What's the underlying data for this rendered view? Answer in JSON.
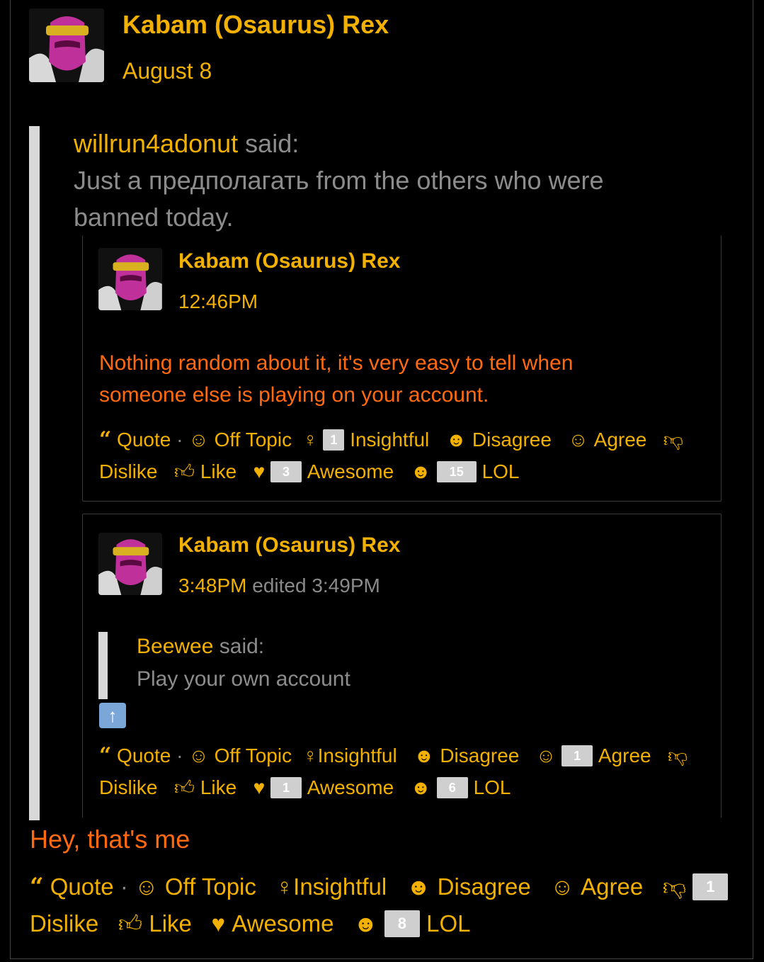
{
  "post": {
    "author": "Kabam (Osaurus) Rex",
    "date": "August 8",
    "quote": {
      "author": "willrun4adonut",
      "said": "said:",
      "line1": "Just a предполагать from the others who were",
      "line2": "banned today.",
      "nested": [
        {
          "author": "Kabam (Osaurus) Rex",
          "time": "12:46PM",
          "text_line1": "Nothing random about it, it's very easy to tell when",
          "text_line2": "someone else is playing on your account.",
          "reactions": {
            "quote": "Quote",
            "off_topic": "Off Topic",
            "insightful_count": "1",
            "insightful": "Insightful",
            "disagree": "Disagree",
            "agree": "Agree",
            "dislike": "Dislike",
            "like": "Like",
            "awesome_count": "3",
            "awesome": "Awesome",
            "lol_count": "15",
            "lol": "LOL"
          }
        },
        {
          "author": "Kabam (Osaurus) Rex",
          "time": "3:48PM",
          "edited": "edited 3:49PM",
          "inner_quote_author": "Beewee",
          "inner_quote_said": "said:",
          "inner_quote_text": "Play your own account",
          "reactions": {
            "quote": "Quote",
            "off_topic": "Off Topic",
            "insightful": "Insightful",
            "disagree": "Disagree",
            "agree_count": "1",
            "agree": "Agree",
            "dislike": "Dislike",
            "like": "Like",
            "awesome_count": "1",
            "awesome": "Awesome",
            "lol_count": "6",
            "lol": "LOL"
          }
        }
      ]
    },
    "body": "Hey, that's me",
    "reactions": {
      "quote": "Quote",
      "off_topic": "Off Topic",
      "insightful": "Insightful",
      "disagree": "Disagree",
      "agree": "Agree",
      "dislike_count": "1",
      "dislike": "Dislike",
      "like": "Like",
      "awesome": "Awesome",
      "lol_count": "8",
      "lol": "LOL"
    }
  },
  "colors": {
    "accent": "#f2b100",
    "orange_text": "#ff6a10",
    "quote_gray": "#8c8c8c",
    "badge": "#cfcfcf"
  }
}
